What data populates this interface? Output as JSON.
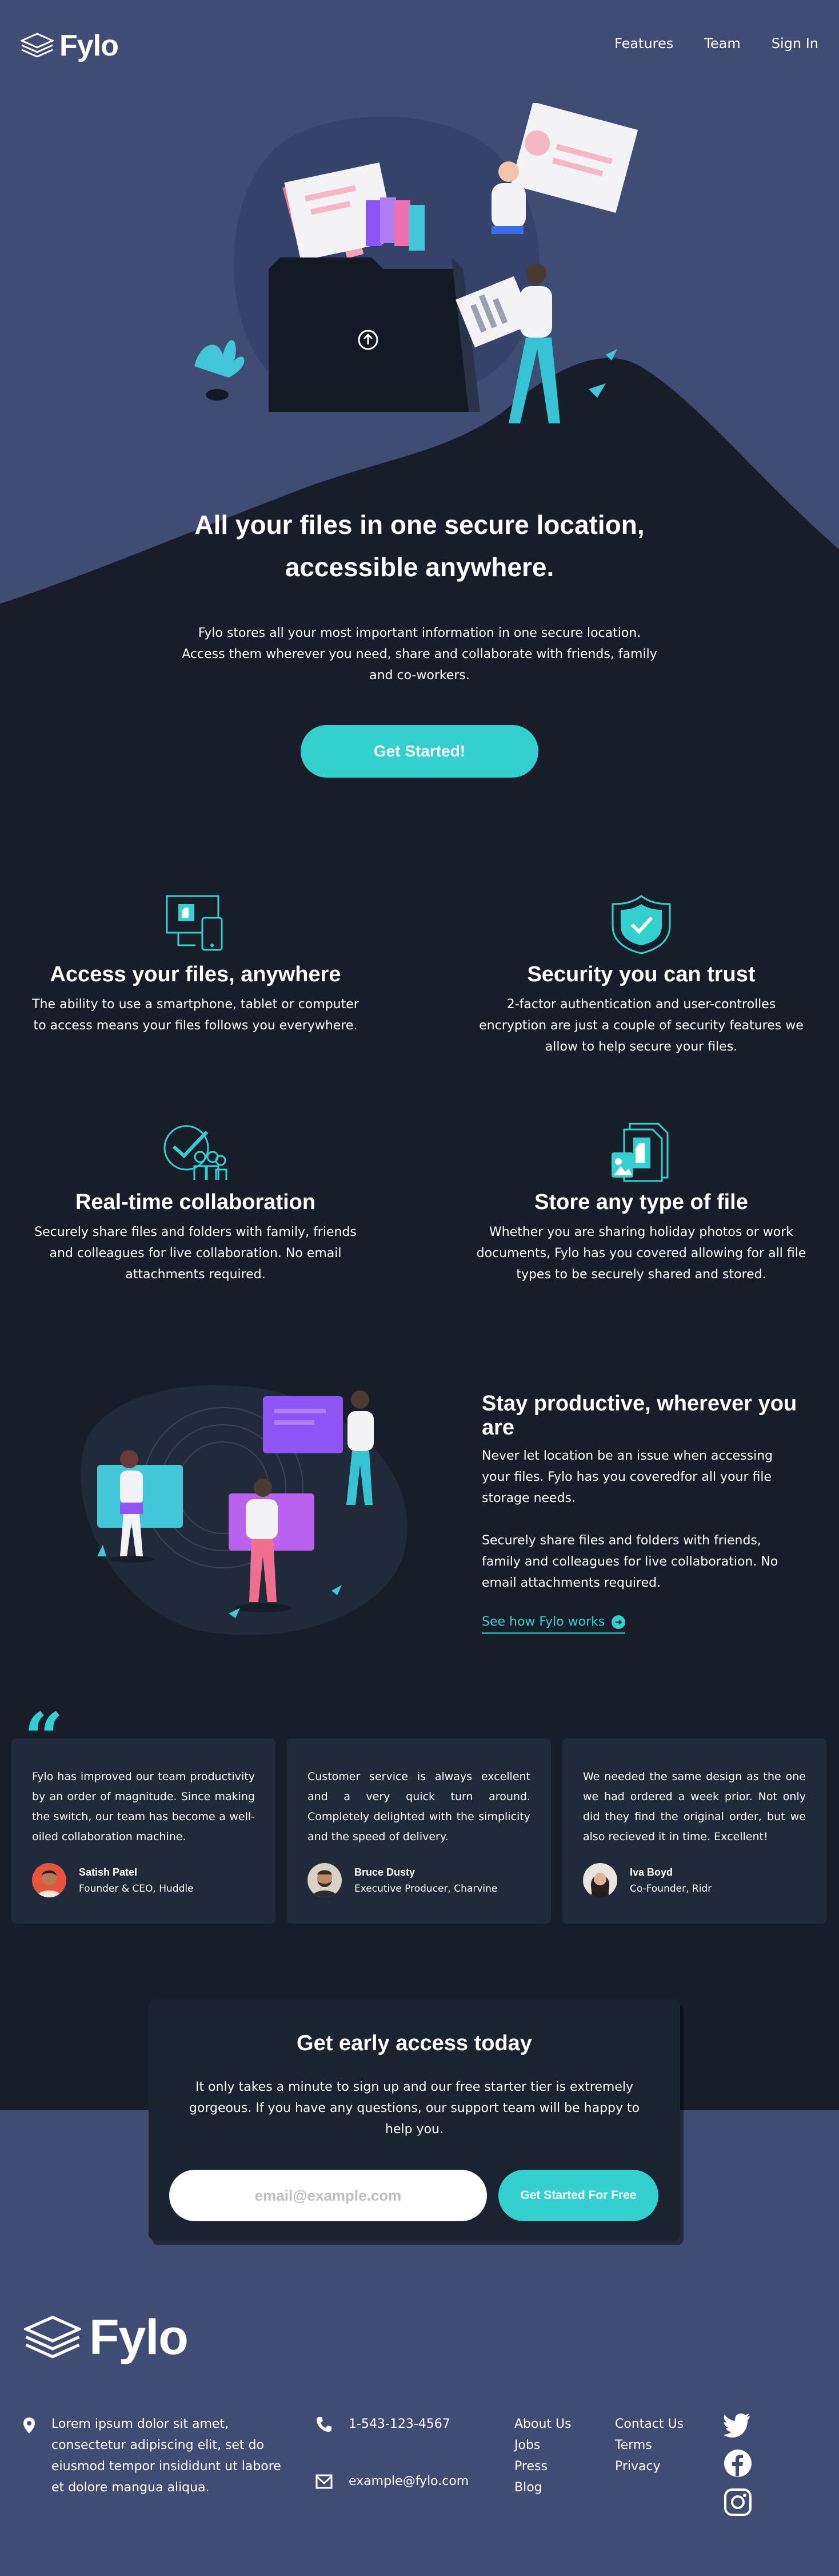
{
  "header": {
    "logo_text": "Fylo",
    "nav": [
      "Features",
      "Team",
      "Sign In"
    ]
  },
  "hero": {
    "title": "All your files in one secure location, accessible anywhere.",
    "text": "Fylo stores all your most important information in one secure location. Access them wherever you need, share and collaborate with friends, family and co-workers.",
    "cta": "Get Started!"
  },
  "features": [
    {
      "icon": "devices-icon",
      "title": "Access your files, anywhere",
      "text": "The ability to use a smartphone, tablet or computer to access means your files follows you everywhere."
    },
    {
      "icon": "security-shield-icon",
      "title": "Security you can trust",
      "text": "2-factor authentication and user-controlles encryption are just a couple of security features we allow to help secure your files."
    },
    {
      "icon": "collaboration-icon",
      "title": "Real-time collaboration",
      "text": "Securely share files and folders with family, friends and colleagues for live collaboration. No email attachments required."
    },
    {
      "icon": "file-types-icon",
      "title": "Store any type of file",
      "text": "Whether you are sharing holiday photos or work documents, Fylo has you covered allowing for all file types to be securely shared and stored."
    }
  ],
  "productive": {
    "title": "Stay productive, wherever you are",
    "p1": "Never let location be an issue when accessing your files. Fylo has you coveredfor all your file storage needs.",
    "p2": "Securely share files and folders with friends, family and colleagues for live collaboration. No email attachments required.",
    "link": "See how Fylo works"
  },
  "testimonials": [
    {
      "text": "Fylo has improved our team productivity by an order of magnitude. Since making the switch, our team has become a well-oiled collaboration machine.",
      "name": "Satish Patel",
      "role": "Founder & CEO, Huddle"
    },
    {
      "text": "Customer service is always excellent and a very quick turn around. Completely delighted with the simplicity and the speed of delivery.",
      "name": "Bruce Dusty",
      "role": "Executive Producer, Charvine"
    },
    {
      "text": "We needed the same design as the one we had ordered a week prior. Not only did they find the original order, but we also recieved it in time. Excellent!",
      "name": "Iva Boyd",
      "role": "Co-Founder, Ridr"
    }
  ],
  "signup": {
    "title": "Get early access today",
    "text": "It only takes a minute to sign up and our free starter tier is extremely gorgeous. If you have any questions, our support team will be happy to help you.",
    "email_placeholder": "email@example.com",
    "button": "Get Started For Free"
  },
  "footer": {
    "logo_text": "Fylo",
    "address": "Lorem ipsum dolor sit amet, consectetur adipiscing elit, set do eiusmod tempor insididunt ut labore et dolore mangua aliqua.",
    "phone": "1-543-123-4567",
    "email": "example@fylo.com",
    "links_col1": [
      "About Us",
      "Jobs",
      "Press",
      "Blog"
    ],
    "links_col2": [
      "Contact Us",
      "Terms",
      "Privacy"
    ],
    "social": [
      "twitter-icon",
      "facebook-icon",
      "instagram-icon"
    ]
  },
  "colors": {
    "hero_bg": "#3f4d75",
    "page_bg": "#181e29",
    "card_bg": "#212a3b",
    "accent": "#33d0cf"
  }
}
